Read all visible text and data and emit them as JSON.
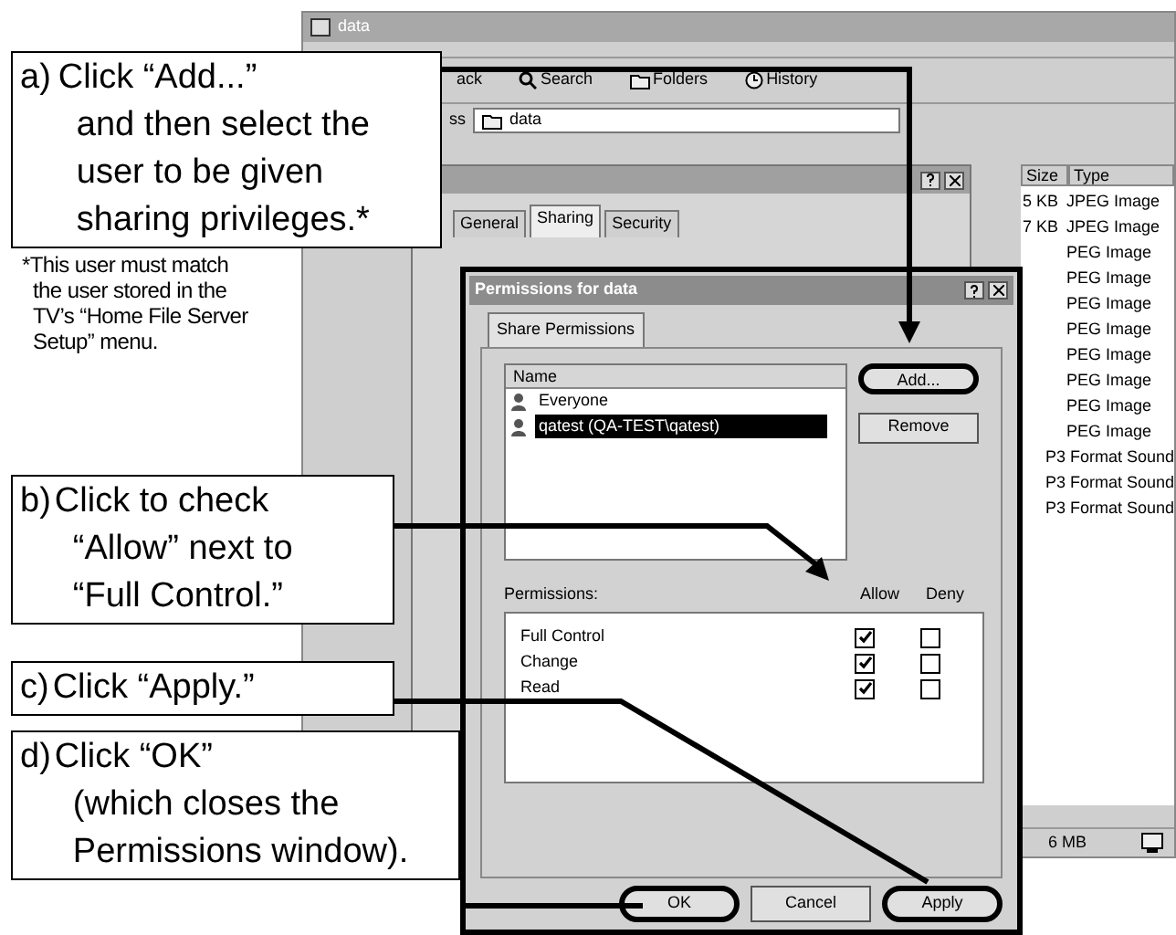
{
  "explorer": {
    "title": "data",
    "toolbar": [
      {
        "kind": "back",
        "label": "ack"
      },
      {
        "kind": "search",
        "label": "Search"
      },
      {
        "kind": "folders",
        "label": "Folders"
      },
      {
        "kind": "history",
        "label": "History"
      }
    ],
    "address_label": "ss",
    "address": "data",
    "columns": [
      "Size",
      "Type"
    ],
    "rows": [
      {
        "size": "5 KB",
        "type": "JPEG Image"
      },
      {
        "size": "7 KB",
        "type": "JPEG Image"
      },
      {
        "size": "",
        "type": "PEG Image"
      },
      {
        "size": "",
        "type": "PEG Image"
      },
      {
        "size": "",
        "type": "PEG Image"
      },
      {
        "size": "",
        "type": "PEG Image"
      },
      {
        "size": "",
        "type": "PEG Image"
      },
      {
        "size": "",
        "type": "PEG Image"
      },
      {
        "size": "",
        "type": "PEG Image"
      },
      {
        "size": "",
        "type": "PEG Image"
      },
      {
        "size": "",
        "type": "P3 Format Sound"
      },
      {
        "size": "",
        "type": "P3 Format Sound"
      },
      {
        "size": "",
        "type": "P3 Format Sound"
      }
    ],
    "status": "6 MB"
  },
  "properties": {
    "tabs": [
      {
        "label": "General",
        "selected": false
      },
      {
        "label": "Sharing",
        "selected": true
      },
      {
        "label": "Security",
        "selected": false
      }
    ]
  },
  "permissions": {
    "title": "Permissions for data",
    "tab": "Share Permissions",
    "name_header": "Name",
    "users": [
      {
        "name": "Everyone",
        "selected": false
      },
      {
        "name": "qatest (QA-TEST\\qatest)",
        "selected": true
      }
    ],
    "side_buttons": [
      {
        "label": "Add...",
        "circled": true
      },
      {
        "label": "Remove",
        "circled": false
      }
    ],
    "permissions_label": "Permissions:",
    "allow_header": "Allow",
    "deny_header": "Deny",
    "rights": [
      {
        "name": "Full Control",
        "allow": true,
        "deny": false
      },
      {
        "name": "Change",
        "allow": true,
        "deny": false
      },
      {
        "name": "Read",
        "allow": true,
        "deny": false
      }
    ],
    "buttons": [
      {
        "label": "OK",
        "circled": true
      },
      {
        "label": "Cancel",
        "circled": false
      },
      {
        "label": "Apply",
        "circled": true
      }
    ]
  },
  "callouts": [
    {
      "marker": "a)",
      "lines": [
        "Click “Add...”",
        "and then select the",
        "user to be given",
        "sharing privileges.*"
      ]
    },
    {
      "marker": "b)",
      "lines": [
        "Click to check",
        "“Allow” next to",
        "“Full Control.”"
      ]
    },
    {
      "marker": "c)",
      "lines": [
        "Click “Apply.”"
      ]
    },
    {
      "marker": "d)",
      "lines": [
        "Click “OK”",
        "(which closes the",
        "Permissions window)."
      ]
    }
  ],
  "note": [
    "*This user must match",
    "the user stored in the",
    "TV’s “Home File Server",
    "Setup” menu."
  ]
}
